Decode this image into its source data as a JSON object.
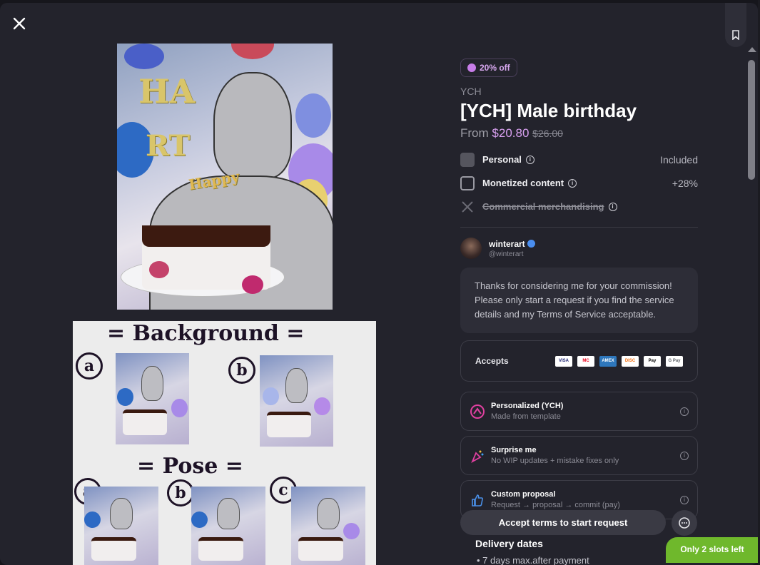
{
  "offer": {
    "discount_badge": "20% off",
    "category": "YCH",
    "title": "[YCH] Male birthday",
    "price_prefix": "From",
    "price_now": "$20.80",
    "price_was": "$26.00"
  },
  "license_options": [
    {
      "label": "Personal",
      "value": "Included",
      "state": "checked"
    },
    {
      "label": "Monetized content",
      "value": "+28%",
      "state": "unchecked"
    },
    {
      "label": "Commercial merchandising",
      "value": "",
      "state": "unavailable"
    }
  ],
  "artist": {
    "name": "winterart",
    "handle": "@winterart",
    "message": "Thanks for considering me for your commission! Please only start a request if you find the service details and my Terms of Service acceptable."
  },
  "payments": {
    "label": "Accepts",
    "methods": [
      "VISA",
      "MC",
      "AMEX",
      "DISC",
      "Pay",
      "G Pay"
    ]
  },
  "request_types": [
    {
      "name": "Personalized (YCH)",
      "desc": "Made from template",
      "icon": "personalized-icon"
    },
    {
      "name": "Surprise me",
      "desc": "No WIP updates + mistake fixes only",
      "icon": "party-popper-icon"
    },
    {
      "name": "Custom proposal",
      "desc": "Request → proposal → commit (pay)",
      "icon": "thumbs-up-icon"
    }
  ],
  "delivery": {
    "title": "Delivery dates",
    "items": [
      "7 days max.after payment"
    ]
  },
  "cta": {
    "label": "Accept terms to start request"
  },
  "slots": {
    "label": "Only 2 slots left"
  },
  "artwork": {
    "ref_background": "= Background =",
    "ref_pose": "= Pose =",
    "letters": [
      "a",
      "b",
      "a",
      "b",
      "c"
    ]
  },
  "colors": {
    "accent": "#d8a0f0",
    "slots": "#6fb82c",
    "panel": "#23232c"
  }
}
